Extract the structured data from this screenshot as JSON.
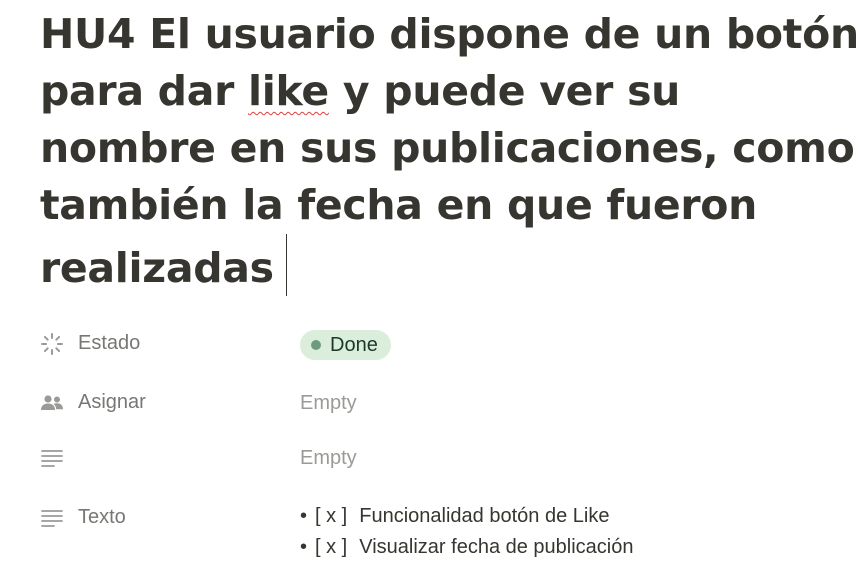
{
  "page": {
    "title_before": "HU4 El usuario dispone de un botón para dar ",
    "title_misspelled": "like",
    "title_after": " y puede ver su nombre en sus publicaciones, como también la fecha en que fueron realizadas"
  },
  "properties": {
    "estado": {
      "label": "Estado",
      "icon": "status-icon",
      "value": "Done",
      "badge_bg": "#dbeddb",
      "dot_color": "#6c9b7d"
    },
    "asignar": {
      "label": "Asignar",
      "icon": "people-icon",
      "value": "Empty"
    },
    "untitled": {
      "label": "",
      "icon": "text-icon",
      "value": "Empty"
    },
    "texto": {
      "label": "Texto",
      "icon": "text-icon",
      "items": [
        {
          "bullet": "•",
          "check": "[ x ]",
          "text": "Funcionalidad botón de Like"
        },
        {
          "bullet": "•",
          "check": "[ x ]",
          "text": "Visualizar fecha de publicación"
        }
      ]
    }
  }
}
